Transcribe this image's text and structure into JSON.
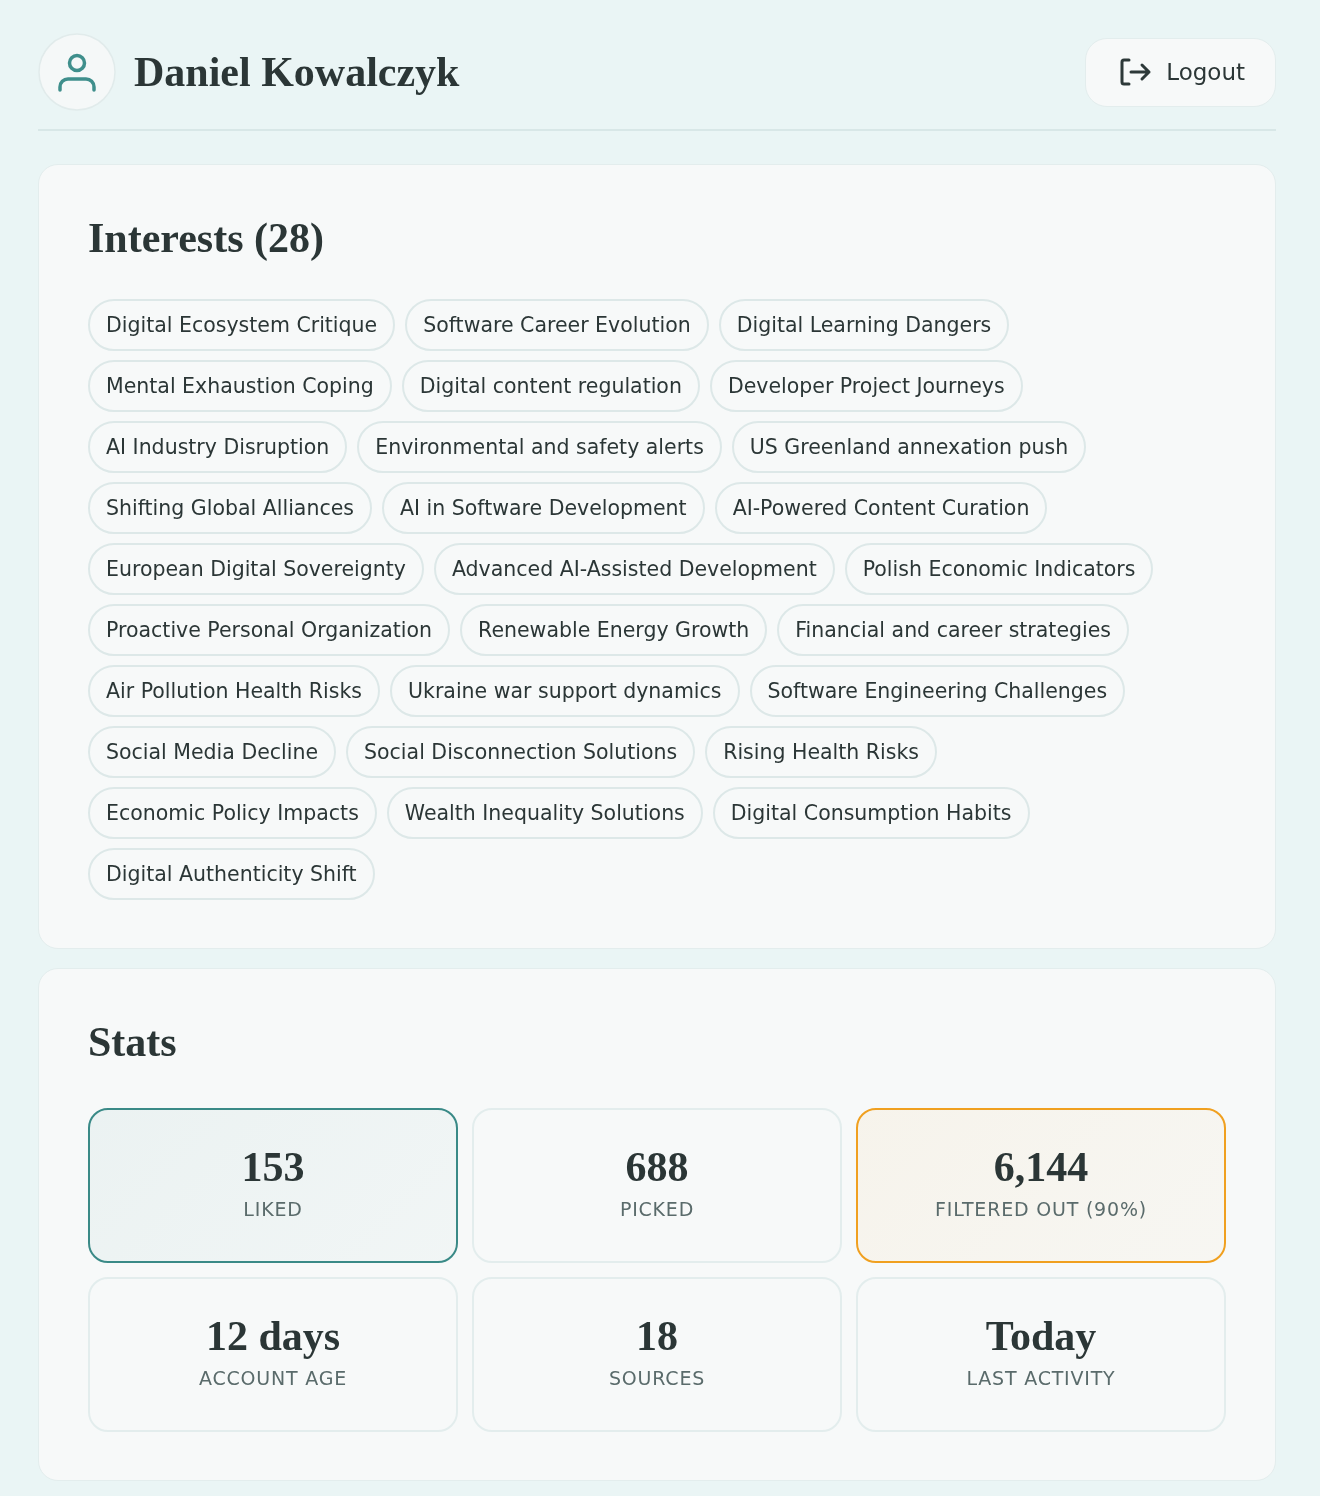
{
  "user": {
    "name": "Daniel Kowalczyk"
  },
  "logout_button": {
    "label": "Logout"
  },
  "interests": {
    "title": "Interests (28)",
    "items": [
      "Digital Ecosystem Critique",
      "Software Career Evolution",
      "Digital Learning Dangers",
      "Mental Exhaustion Coping",
      "Digital content regulation",
      "Developer Project Journeys",
      "AI Industry Disruption",
      "Environmental and safety alerts",
      "US Greenland annexation push",
      "Shifting Global Alliances",
      "AI in Software Development",
      "AI-Powered Content Curation",
      "European Digital Sovereignty",
      "Advanced AI-Assisted Development",
      "Polish Economic Indicators",
      "Proactive Personal Organization",
      "Renewable Energy Growth",
      "Financial and career strategies",
      "Air Pollution Health Risks",
      "Ukraine war support dynamics",
      "Software Engineering Challenges",
      "Social Media Decline",
      "Social Disconnection Solutions",
      "Rising Health Risks",
      "Economic Policy Impacts",
      "Wealth Inequality Solutions",
      "Digital Consumption Habits",
      "Digital Authenticity Shift"
    ]
  },
  "stats": {
    "title": "Stats",
    "items": [
      {
        "value": "153",
        "label": "LIKED",
        "color": "#3a8a87"
      },
      {
        "value": "688",
        "label": "PICKED"
      },
      {
        "value": "6,144",
        "label": "FILTERED OUT (90%)",
        "color": "#f0a020"
      },
      {
        "value": "12 days",
        "label": "ACCOUNT AGE"
      },
      {
        "value": "18",
        "label": "SOURCES"
      },
      {
        "value": "Today",
        "label": "LAST ACTIVITY"
      }
    ]
  }
}
